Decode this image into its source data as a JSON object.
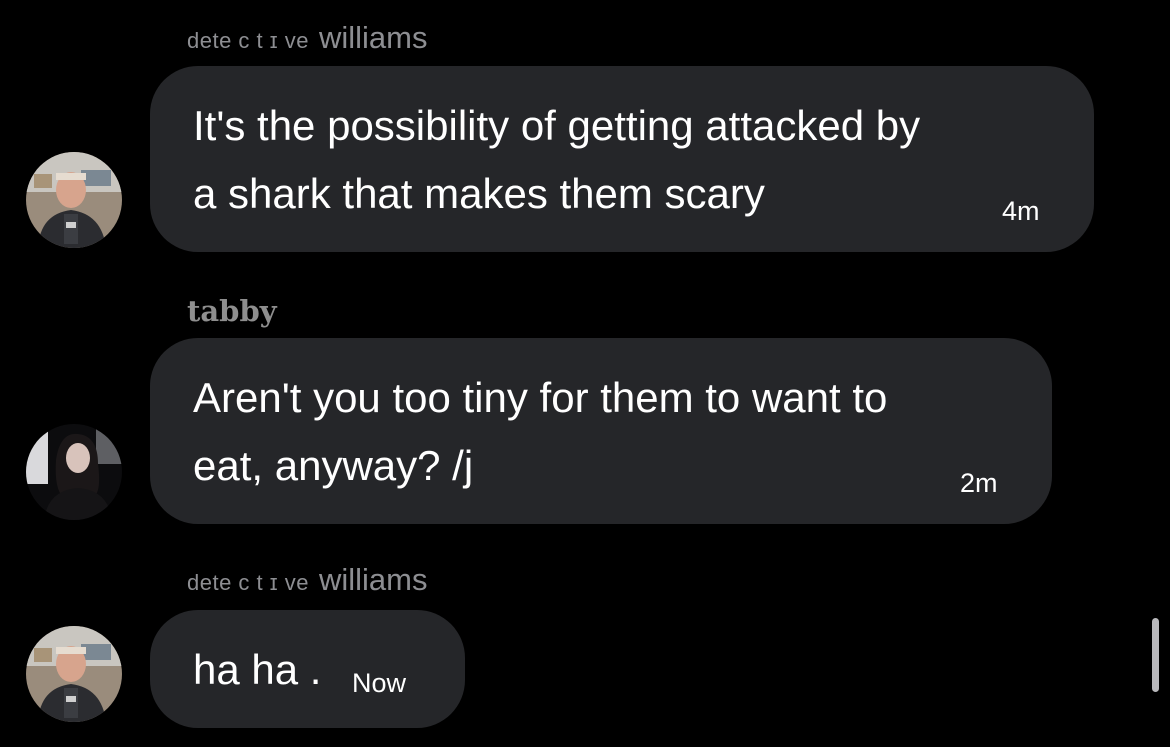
{
  "messages": [
    {
      "sender_prefix": "dete c t ɪ ve",
      "sender_name": "williams",
      "text": "It's the possibility of getting attacked by\na shark that makes them scary",
      "time": "4m"
    },
    {
      "sender_name": "tabby",
      "text": "Aren't you too tiny for them to want to\neat, anyway? /j",
      "time": "2m"
    },
    {
      "sender_prefix": "dete c t ɪ ve",
      "sender_name": "williams",
      "text": "ha ha .",
      "time": "Now"
    }
  ],
  "colors": {
    "background": "#000000",
    "bubble": "#252629",
    "sender_text": "#8d8e92",
    "message_text": "#ffffff"
  }
}
